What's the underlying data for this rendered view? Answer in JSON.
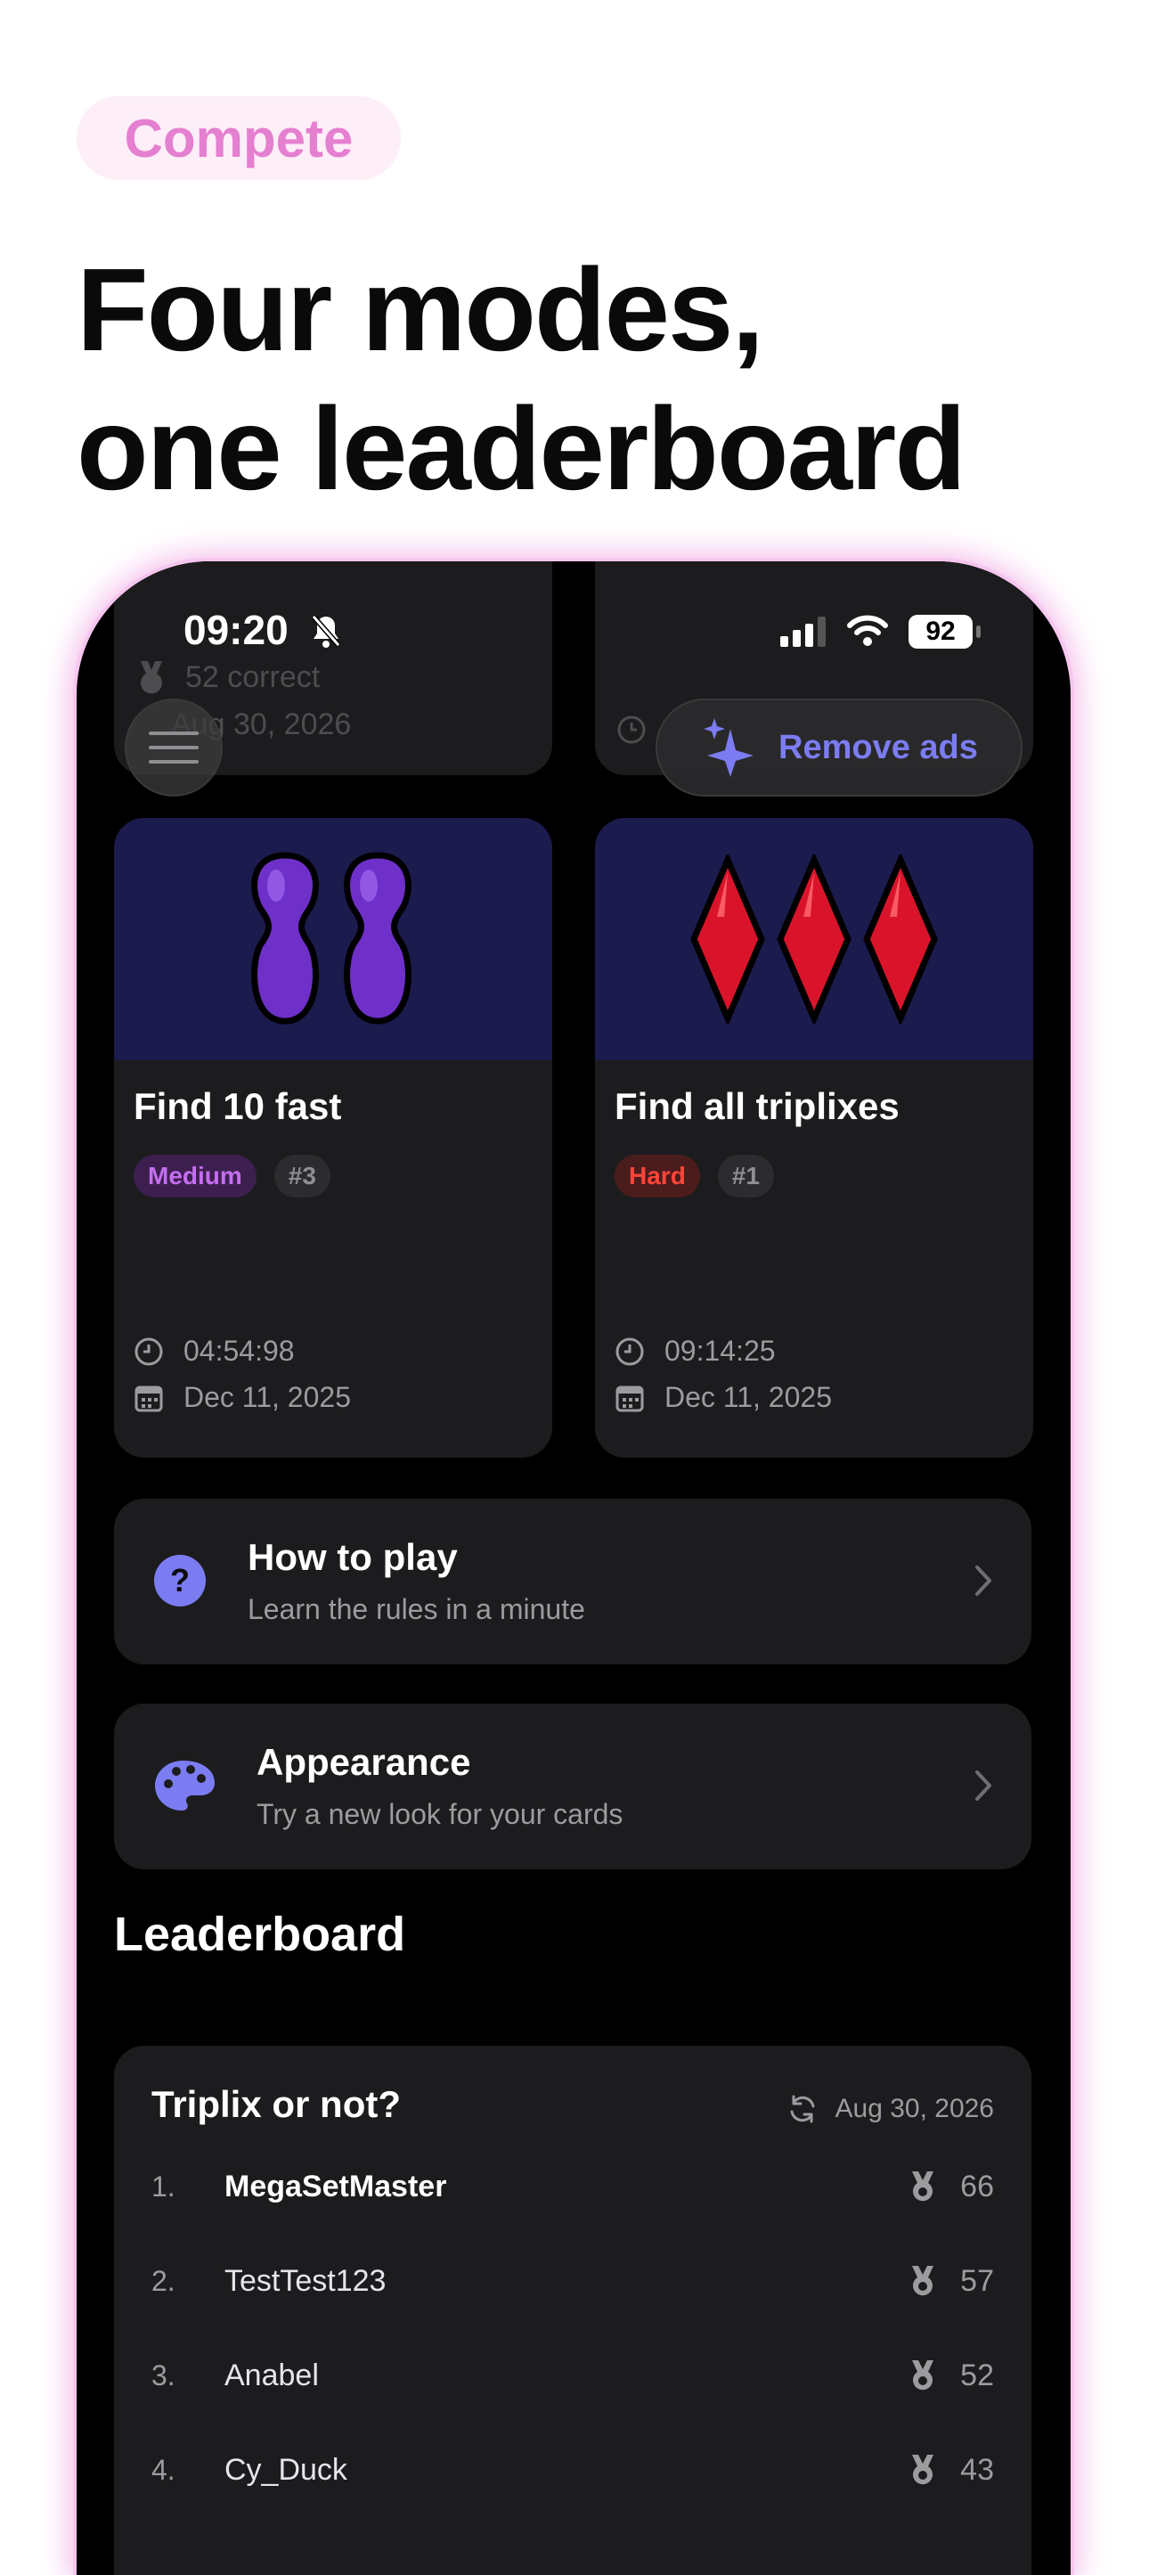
{
  "marketing": {
    "chip": "Compete",
    "headline_line1": "Four modes,",
    "headline_line2": "one leaderboard"
  },
  "status_bar": {
    "time": "09:20",
    "battery": "92"
  },
  "background_card": {
    "stat": "52 correct",
    "date": "Aug 30, 2026"
  },
  "remove_ads": {
    "label": "Remove ads"
  },
  "mode_cards": [
    {
      "title": "Find 10 fast",
      "difficulty": "Medium",
      "rank": "#3",
      "time": "04:54:98",
      "date": "Dec 11, 2025"
    },
    {
      "title": "Find all triplixes",
      "difficulty": "Hard",
      "rank": "#1",
      "time": "09:14:25",
      "date": "Dec 11, 2025"
    }
  ],
  "rows": [
    {
      "title": "How to play",
      "subtitle": "Learn the rules in a minute"
    },
    {
      "title": "Appearance",
      "subtitle": "Try a new look for your cards"
    }
  ],
  "leaderboard": {
    "heading": "Leaderboard",
    "card_title": "Triplix or not?",
    "updated": "Aug 30, 2026",
    "entries": [
      {
        "rank": "1.",
        "name": "MegaSetMaster",
        "score": "66"
      },
      {
        "rank": "2.",
        "name": "TestTest123",
        "score": "57"
      },
      {
        "rank": "3.",
        "name": "Anabel",
        "score": "52"
      },
      {
        "rank": "4.",
        "name": "Cy_Duck",
        "score": "43"
      }
    ]
  },
  "colors": {
    "accent": "#7c7cf2",
    "medium": "#c56ef0",
    "hard": "#ff453a",
    "card_bg": "#1c1c1e",
    "art_bg": "#1b1b4d",
    "purple_shape": "#6f2fc9",
    "red_shape": "#d9142a",
    "chip_text": "#e57fd0"
  }
}
